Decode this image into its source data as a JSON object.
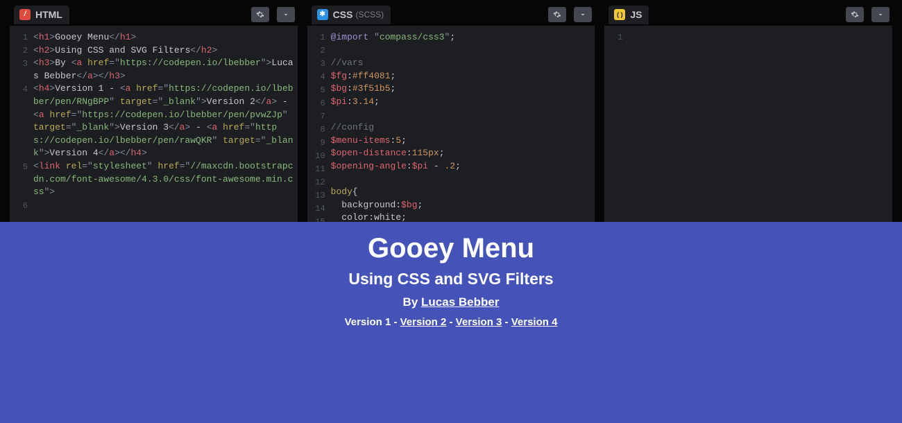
{
  "panels": {
    "html": {
      "title": "HTML",
      "sub": "",
      "icon_bg": "#df4a3f",
      "icon_txt": "/"
    },
    "css": {
      "title": "CSS",
      "sub": "(SCSS)",
      "icon_bg": "#2d91e3",
      "icon_txt": "✱"
    },
    "js": {
      "title": "JS",
      "sub": "",
      "icon_bg": "#f0c93a",
      "icon_txt": "()"
    }
  },
  "html_lines": [
    {
      "n": "1",
      "segs": [
        {
          "c": "p",
          "v": "<"
        },
        {
          "c": "t",
          "v": "h1"
        },
        {
          "c": "p",
          "v": ">"
        },
        {
          "c": "tx",
          "v": "Gooey Menu"
        },
        {
          "c": "p",
          "v": "</"
        },
        {
          "c": "t",
          "v": "h1"
        },
        {
          "c": "p",
          "v": ">"
        }
      ]
    },
    {
      "n": "2",
      "segs": [
        {
          "c": "p",
          "v": "<"
        },
        {
          "c": "t",
          "v": "h2"
        },
        {
          "c": "p",
          "v": ">"
        },
        {
          "c": "tx",
          "v": "Using CSS and SVG Filters"
        },
        {
          "c": "p",
          "v": "</"
        },
        {
          "c": "t",
          "v": "h2"
        },
        {
          "c": "p",
          "v": ">"
        }
      ]
    },
    {
      "n": "3",
      "segs": [
        {
          "c": "p",
          "v": "<"
        },
        {
          "c": "t",
          "v": "h3"
        },
        {
          "c": "p",
          "v": ">"
        },
        {
          "c": "tx",
          "v": "By "
        },
        {
          "c": "p",
          "v": "<"
        },
        {
          "c": "t",
          "v": "a"
        },
        {
          "c": "p",
          "v": " "
        },
        {
          "c": "a",
          "v": "href"
        },
        {
          "c": "p",
          "v": "="
        },
        {
          "c": "p",
          "v": "\""
        },
        {
          "c": "s",
          "v": "https://codepen.io/lbebber"
        },
        {
          "c": "p",
          "v": "\""
        },
        {
          "c": "p",
          "v": ">"
        },
        {
          "c": "tx",
          "v": "Lucas Bebber"
        },
        {
          "c": "p",
          "v": "</"
        },
        {
          "c": "t",
          "v": "a"
        },
        {
          "c": "p",
          "v": ">"
        },
        {
          "c": "p",
          "v": "</"
        },
        {
          "c": "t",
          "v": "h3"
        },
        {
          "c": "p",
          "v": ">"
        }
      ]
    },
    {
      "n": "4",
      "segs": [
        {
          "c": "p",
          "v": "<"
        },
        {
          "c": "t",
          "v": "h4"
        },
        {
          "c": "p",
          "v": ">"
        },
        {
          "c": "tx",
          "v": "Version 1"
        },
        {
          "c": "tx",
          "v": " - "
        },
        {
          "c": "p",
          "v": "<"
        },
        {
          "c": "t",
          "v": "a"
        },
        {
          "c": "p",
          "v": " "
        },
        {
          "c": "a",
          "v": "href"
        },
        {
          "c": "p",
          "v": "=\""
        },
        {
          "c": "s",
          "v": "https://codepen.io/lbebber/pen/RNgBPP"
        },
        {
          "c": "p",
          "v": "\" "
        },
        {
          "c": "a",
          "v": "target"
        },
        {
          "c": "p",
          "v": "=\""
        },
        {
          "c": "s",
          "v": "_blank"
        },
        {
          "c": "p",
          "v": "\">"
        },
        {
          "c": "tx",
          "v": "Version 2"
        },
        {
          "c": "p",
          "v": "</"
        },
        {
          "c": "t",
          "v": "a"
        },
        {
          "c": "p",
          "v": ">"
        },
        {
          "c": "tx",
          "v": " - "
        },
        {
          "c": "p",
          "v": "<"
        },
        {
          "c": "t",
          "v": "a"
        },
        {
          "c": "p",
          "v": " "
        },
        {
          "c": "a",
          "v": "href"
        },
        {
          "c": "p",
          "v": "=\""
        },
        {
          "c": "s",
          "v": "https://codepen.io/lbebber/pen/pvwZJp"
        },
        {
          "c": "p",
          "v": "\" "
        },
        {
          "c": "a",
          "v": "target"
        },
        {
          "c": "p",
          "v": "=\""
        },
        {
          "c": "s",
          "v": "_blank"
        },
        {
          "c": "p",
          "v": "\">"
        },
        {
          "c": "tx",
          "v": "Version 3"
        },
        {
          "c": "p",
          "v": "</"
        },
        {
          "c": "t",
          "v": "a"
        },
        {
          "c": "p",
          "v": ">"
        },
        {
          "c": "tx",
          "v": " - "
        },
        {
          "c": "p",
          "v": "<"
        },
        {
          "c": "t",
          "v": "a"
        },
        {
          "c": "p",
          "v": " "
        },
        {
          "c": "a",
          "v": "href"
        },
        {
          "c": "p",
          "v": "=\""
        },
        {
          "c": "s",
          "v": "https://codepen.io/lbebber/pen/rawQKR"
        },
        {
          "c": "p",
          "v": "\" "
        },
        {
          "c": "a",
          "v": "target"
        },
        {
          "c": "p",
          "v": "=\""
        },
        {
          "c": "s",
          "v": "_blank"
        },
        {
          "c": "p",
          "v": "\">"
        },
        {
          "c": "tx",
          "v": "Version 4"
        },
        {
          "c": "p",
          "v": "</"
        },
        {
          "c": "t",
          "v": "a"
        },
        {
          "c": "p",
          "v": ">"
        },
        {
          "c": "p",
          "v": "</"
        },
        {
          "c": "t",
          "v": "h4"
        },
        {
          "c": "p",
          "v": ">"
        }
      ]
    },
    {
      "n": "5",
      "segs": [
        {
          "c": "p",
          "v": "<"
        },
        {
          "c": "t",
          "v": "link"
        },
        {
          "c": "p",
          "v": " "
        },
        {
          "c": "a",
          "v": "rel"
        },
        {
          "c": "p",
          "v": "=\""
        },
        {
          "c": "s",
          "v": "stylesheet"
        },
        {
          "c": "p",
          "v": "\" "
        },
        {
          "c": "a",
          "v": "href"
        },
        {
          "c": "p",
          "v": "=\""
        },
        {
          "c": "s",
          "v": "//maxcdn.bootstrapcdn.com/font-awesome/4.3.0/css/font-awesome.min.css"
        },
        {
          "c": "p",
          "v": "\">"
        }
      ]
    },
    {
      "n": "6",
      "segs": []
    }
  ],
  "css_lines": [
    {
      "n": "1",
      "segs": [
        {
          "c": "kw",
          "v": "@import"
        },
        {
          "c": "pn",
          "v": " "
        },
        {
          "c": "p",
          "v": "\""
        },
        {
          "c": "cs",
          "v": "compass/css3"
        },
        {
          "c": "p",
          "v": "\""
        },
        {
          "c": "pn",
          "v": ";"
        }
      ]
    },
    {
      "n": "2",
      "segs": []
    },
    {
      "n": "3",
      "segs": [
        {
          "c": "cm",
          "v": "//vars"
        }
      ]
    },
    {
      "n": "4",
      "segs": [
        {
          "c": "vr",
          "v": "$fg"
        },
        {
          "c": "pn",
          "v": ":"
        },
        {
          "c": "hx",
          "v": "#ff4081"
        },
        {
          "c": "pn",
          "v": ";"
        }
      ]
    },
    {
      "n": "5",
      "segs": [
        {
          "c": "vr",
          "v": "$bg"
        },
        {
          "c": "pn",
          "v": ":"
        },
        {
          "c": "hx",
          "v": "#3f51b5"
        },
        {
          "c": "pn",
          "v": ";"
        }
      ]
    },
    {
      "n": "6",
      "segs": [
        {
          "c": "vr",
          "v": "$pi"
        },
        {
          "c": "pn",
          "v": ":"
        },
        {
          "c": "nu",
          "v": "3.14"
        },
        {
          "c": "pn",
          "v": ";"
        }
      ]
    },
    {
      "n": "7",
      "segs": []
    },
    {
      "n": "8",
      "segs": [
        {
          "c": "cm",
          "v": "//config"
        }
      ]
    },
    {
      "n": "9",
      "segs": [
        {
          "c": "vr",
          "v": "$menu-items"
        },
        {
          "c": "pn",
          "v": ":"
        },
        {
          "c": "nu",
          "v": "5"
        },
        {
          "c": "pn",
          "v": ";"
        }
      ]
    },
    {
      "n": "10",
      "segs": [
        {
          "c": "vr",
          "v": "$open-distance"
        },
        {
          "c": "pn",
          "v": ":"
        },
        {
          "c": "nu",
          "v": "115px"
        },
        {
          "c": "pn",
          "v": ";"
        }
      ]
    },
    {
      "n": "11",
      "segs": [
        {
          "c": "vr",
          "v": "$opening-angle"
        },
        {
          "c": "pn",
          "v": ":"
        },
        {
          "c": "vr",
          "v": "$pi"
        },
        {
          "c": "pn",
          "v": " - "
        },
        {
          "c": "nu",
          "v": ".2"
        },
        {
          "c": "pn",
          "v": ";"
        }
      ]
    },
    {
      "n": "12",
      "segs": []
    },
    {
      "n": "13",
      "segs": [
        {
          "c": "sl",
          "v": "body"
        },
        {
          "c": "pn",
          "v": "{"
        }
      ]
    },
    {
      "n": "14",
      "segs": [
        {
          "c": "pn",
          "v": "  "
        },
        {
          "c": "id",
          "v": "background"
        },
        {
          "c": "pn",
          "v": ":"
        },
        {
          "c": "vr",
          "v": "$bg"
        },
        {
          "c": "pn",
          "v": ";"
        }
      ]
    },
    {
      "n": "15",
      "segs": [
        {
          "c": "pn",
          "v": "  "
        },
        {
          "c": "id",
          "v": "color"
        },
        {
          "c": "pn",
          "v": ":"
        },
        {
          "c": "id",
          "v": "white"
        },
        {
          "c": "pn",
          "v": ";"
        }
      ]
    }
  ],
  "js_lines": [
    {
      "n": "1",
      "segs": []
    }
  ],
  "preview": {
    "h1": "Gooey Menu",
    "h2": "Using CSS and SVG Filters",
    "by": "By ",
    "author": "Lucas Bebber",
    "v1": "Version 1",
    "v2": "Version 2",
    "v3": "Version 3",
    "v4": "Version 4",
    "sep": " - "
  }
}
